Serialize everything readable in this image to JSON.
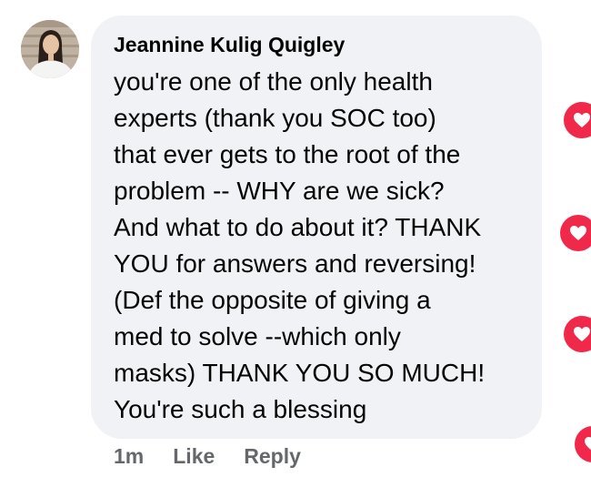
{
  "comment": {
    "author": "Jeannine Kulig Quigley",
    "text": "you're one of the only health\nexperts (thank you SOC too)\nthat ever gets to the root of the\nproblem -- WHY are we sick?\nAnd what to do about it? THANK\nYOU for answers and reversing!\n(Def the opposite of giving a\nmed to solve --which only\nmasks) THANK YOU SO MUCH!\nYou're such a blessing",
    "actions": {
      "time": "1m",
      "like": "Like",
      "reply": "Reply"
    }
  },
  "reaction": {
    "icon": "love-heart-icon",
    "color": "#f0284a"
  }
}
